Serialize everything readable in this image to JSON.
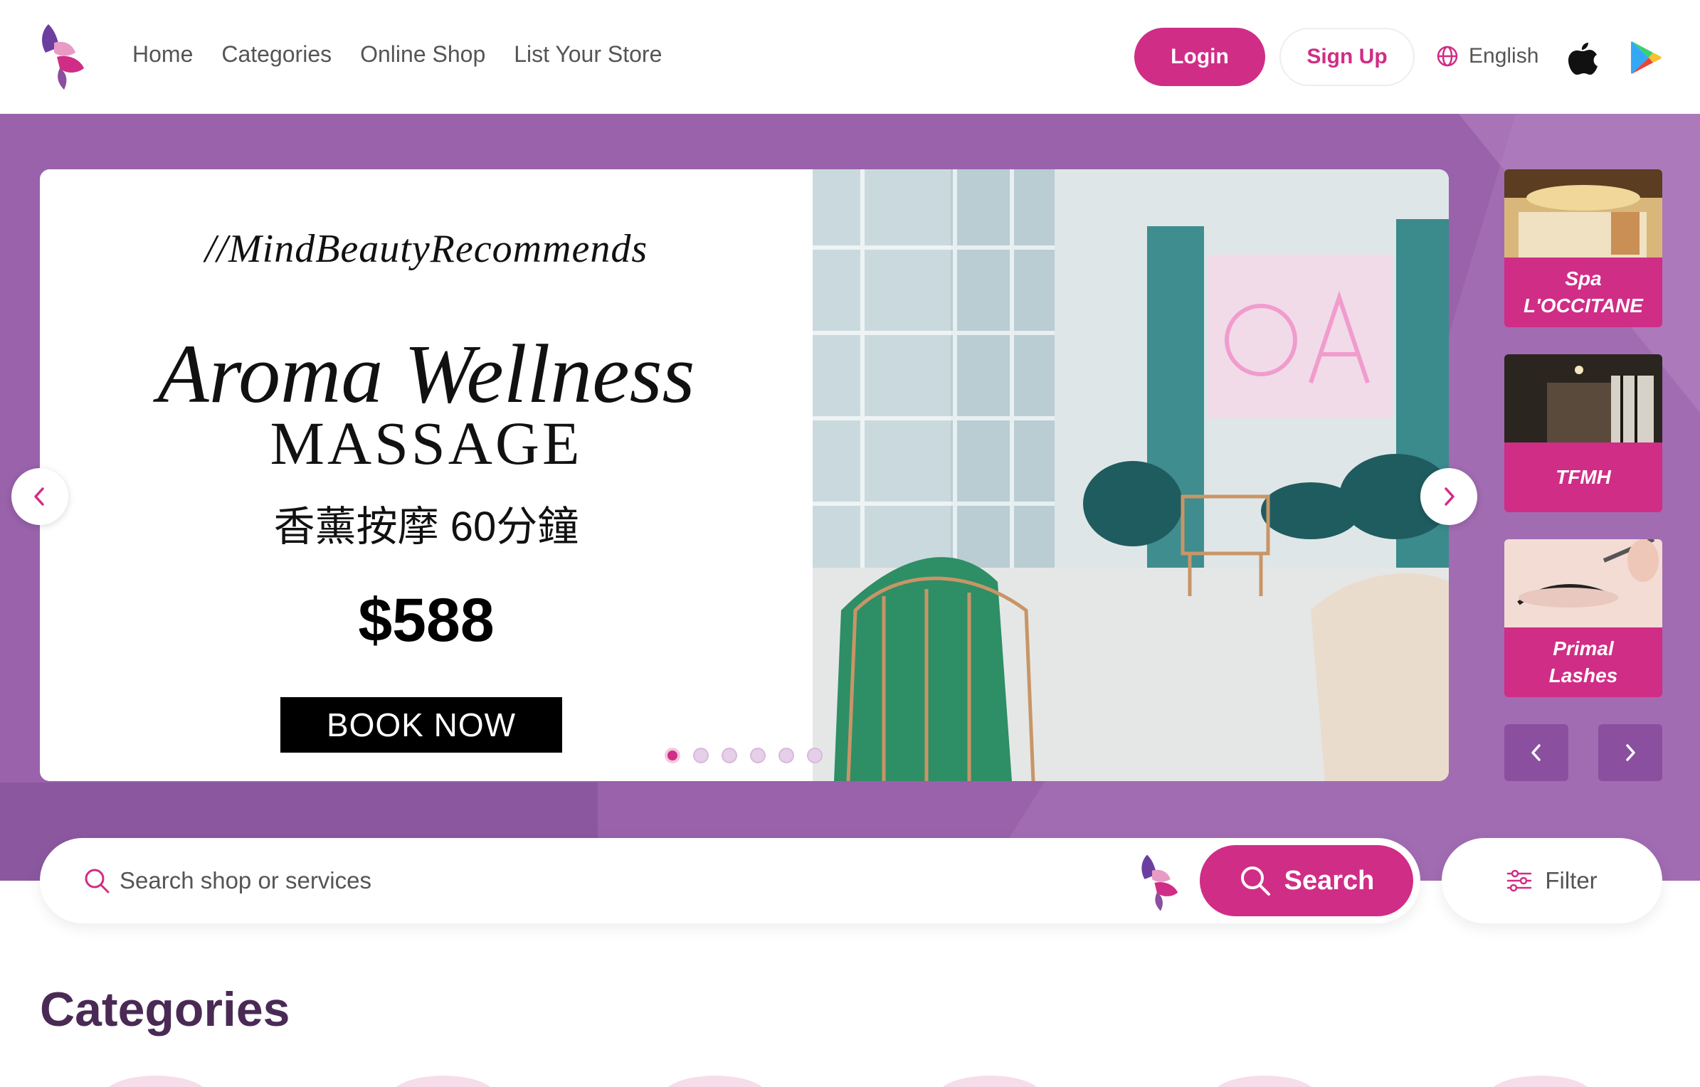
{
  "nav": {
    "links": [
      "Home",
      "Categories",
      "Online Shop",
      "List Your Store"
    ],
    "login_label": "Login",
    "signup_label": "Sign Up",
    "language": "English",
    "icons": [
      "brand-logo",
      "globe-icon",
      "apple-icon",
      "google-play-icon"
    ]
  },
  "banner": {
    "tagline": "//MindBeautyRecommends",
    "title_line1": "Aroma Wellness",
    "title_line2": "MASSAGE",
    "title_line3": "香薰按摩 60分鐘",
    "price": "$588",
    "cta": "BOOK NOW",
    "slide_count": 6,
    "active_slide": 1
  },
  "featured_shops": [
    {
      "name": "Spa\nL'OCCITANE"
    },
    {
      "name": "TFMH"
    },
    {
      "name": "Primal\nLashes"
    }
  ],
  "search": {
    "placeholder": "Search shop or services",
    "button_label": "Search",
    "filter_label": "Filter"
  },
  "categories": {
    "heading": "Categories"
  },
  "colors": {
    "brand_pink": "#d02d86",
    "hero_purple": "#9b62ae",
    "heading_purple": "#4a2a55"
  }
}
